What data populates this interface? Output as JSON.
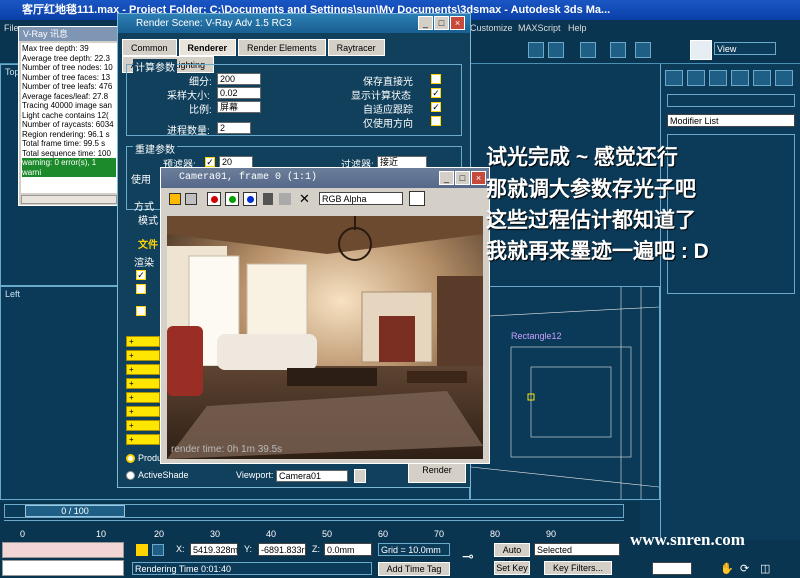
{
  "app": {
    "title": "客厅红地毯111.max - Project Folder: C:\\Documents and Settings\\sun\\My Documents\\3dsmax - Autodesk 3ds Ma...",
    "menu": [
      "File",
      "Customize",
      "MAXScript",
      "Help"
    ],
    "viewport_labels": {
      "top": "Top",
      "left": "Left"
    },
    "view_dropdown": "View"
  },
  "vray_log": {
    "title": "V-Ray 讯息",
    "lines": [
      "Max tree depth: 39",
      "Average tree depth: 22.3",
      "Number of tree nodes: 10",
      "Number of tree faces: 13",
      "Number of tree leafs: 476",
      "Average faces/leaf: 27.8",
      "Tracing 40000 image san",
      "Light cache contains 12(",
      "Number of raycasts: 6034",
      "Region rendering: 96.1 s",
      "Total frame time: 99.5 s",
      "Total sequence time: 100"
    ],
    "warning": "warning: 0 error(s), 1 warni"
  },
  "render_scene": {
    "title": "Render Scene: V-Ray Adv 1.5 RC3",
    "tabs": [
      "Common",
      "Renderer",
      "Render Elements",
      "Raytracer",
      "Advanced Lighting"
    ],
    "active_tab": "Renderer",
    "calc_section": "计算参数",
    "subdivs_label": "细分:",
    "subdivs_value": "200",
    "sample_size_label": "采样大小:",
    "sample_size_value": "0.02",
    "scale_label": "比例:",
    "scale_value": "屏幕",
    "passes_label": "进程数量:",
    "passes_value": "2",
    "store_direct_label": "保存直接光",
    "show_calc_label": "显示计算状态",
    "adaptive_label": "自适应跟踪",
    "use_dir_label": "仅使用方向",
    "rebuild_section": "重建参数",
    "prefilter_label": "预滤器:",
    "prefilter_value": "20",
    "filter_label": "过滤器:",
    "filter_value": "接近",
    "use_label": "使用",
    "mode_label": "方式",
    "mode_sub": "模式",
    "file_label": "文件",
    "render_end_label": "渲染",
    "yellow_bars": [
      "+",
      "+",
      "+",
      "+",
      "+",
      "+",
      "+",
      "+"
    ],
    "production_label": "Production",
    "activeshade_label": "ActiveShade",
    "viewport_label": "Viewport:",
    "viewport_value": "Camera01",
    "render_button": "Render"
  },
  "camera_window": {
    "title": "Camera01, frame 0 (1:1)",
    "channel_value": "RGB Alpha",
    "render_time": "render time: 0h 1m 39.5s"
  },
  "overlay_text": [
    "试光完成 ~ 感觉还行",
    "那就调大参数存光子吧",
    "这些过程估计都知道了",
    "我就再来墨迹一遍吧 : D"
  ],
  "command_panel": {
    "modifier_list": "Modifier List"
  },
  "scene_label": "Rectangle12",
  "timeline": {
    "frame": "0 / 100",
    "ticks": [
      "0",
      "10",
      "20",
      "30",
      "40",
      "50",
      "60",
      "70",
      "80",
      "90"
    ]
  },
  "status": {
    "x_label": "X:",
    "x_value": "5419.328m",
    "y_label": "Y:",
    "y_value": "-6891.833r",
    "z_label": "Z:",
    "z_value": "0.0mm",
    "grid": "Grid = 10.0mm",
    "rendering_time": "Rendering Time  0:01:40",
    "add_time_tag": "Add Time Tag",
    "auto_key": "Auto Key",
    "set_key": "Set Key",
    "selected": "Selected",
    "key_filters": "Key Filters..."
  },
  "watermark": "www.snren.com",
  "colors": {
    "title_blue": "#1a57c4",
    "panel_bg": "#10405c",
    "yellow": "#ffe600",
    "warning_green": "#1c8a2a"
  }
}
